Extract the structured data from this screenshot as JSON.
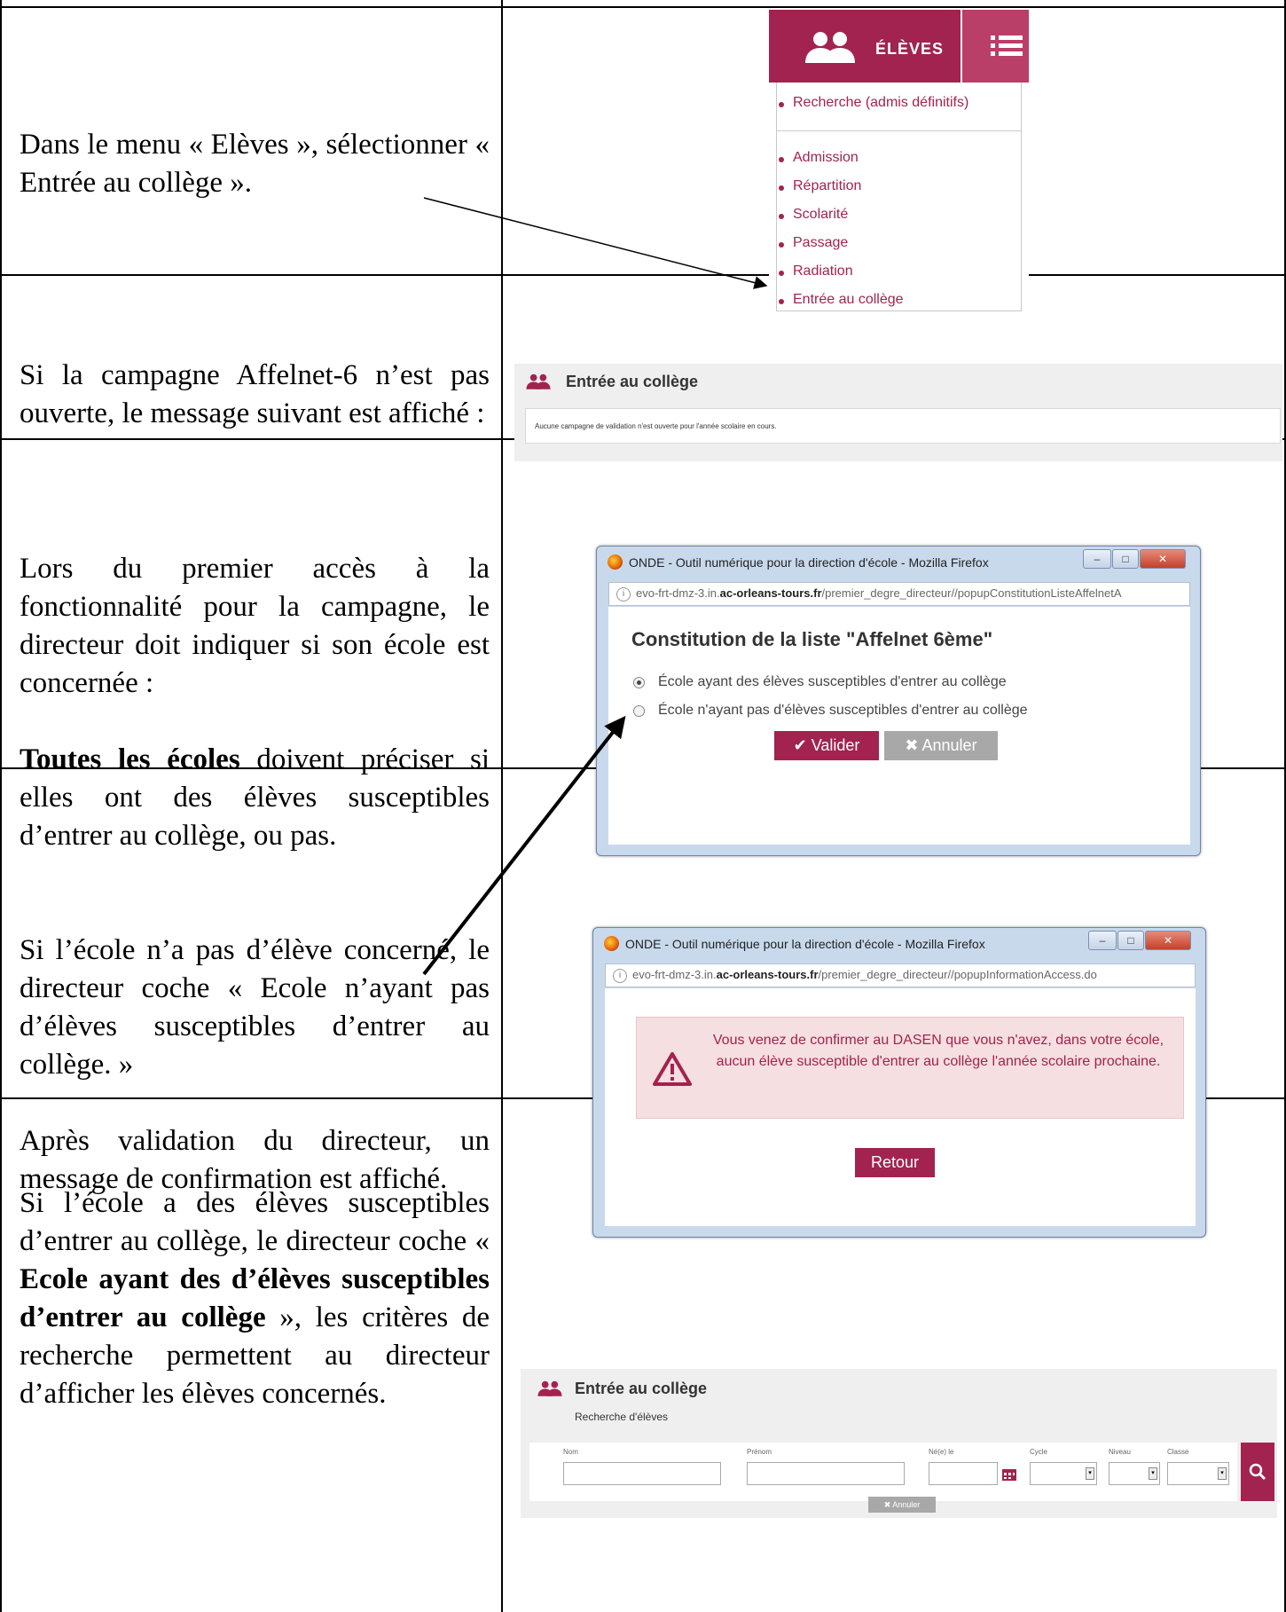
{
  "rows": [
    {
      "paragraphs": [
        [
          "Dans le menu « Elèves », sélectionner « Entrée au collège »."
        ]
      ]
    },
    {
      "paragraphs": [
        [
          "Si la campagne Affelnet-6 n’est pas ouverte, le message suivant est affiché :"
        ]
      ]
    },
    {
      "p1": "Lors du premier accès à la fonctionnalité pour la campagne, le directeur doit indiquer si son école est concernée :",
      "p2_bold": "Toutes les écoles",
      "p2_rest": " doivent préciser si elles ont des élèves susceptibles d’entrer au collège, ou pas."
    },
    {
      "p1": "Si l’école n’a pas d’élève concerné, le directeur coche « Ecole n’ayant pas d’élèves susceptibles d’entrer au collège. »",
      "p2": "Après validation du directeur, un message de confirmation est affiché."
    },
    {
      "p1_a": "Si l’école a des élèves susceptibles d’entrer au collège, le directeur coche « ",
      "p1_bold": "Ecole ayant des d’élèves susceptibles d’entrer au collège",
      "p1_b": " », les critères de recherche permettent au directeur d’afficher les élèves concernés."
    }
  ],
  "menu": {
    "header": "ÉLÈVES",
    "items": [
      "Recherche (admis définitifs)",
      "Admission",
      "Répartition",
      "Scolarité",
      "Passage",
      "Radiation",
      "Entrée au collège"
    ]
  },
  "entree_panel": {
    "title": "Entrée au collège",
    "message": "Aucune campagne de validation n'est ouverte pour l'année scolaire en cours."
  },
  "window1": {
    "title": "ONDE - Outil numérique pour la direction d'école - Mozilla Firefox",
    "url_prefix": "evo-frt-dmz-3.in.",
    "url_domain": "ac-orleans-tours.fr",
    "url_path": "/premier_degre_directeur//popupConstitutionListeAffelnetA",
    "heading": "Constitution de la liste \"Affelnet 6ème\"",
    "option1": "École ayant des élèves susceptibles d'entrer au collège",
    "option2": "École n'ayant pas d'élèves susceptibles d'entrer au collège",
    "valider": "Valider",
    "annuler": "Annuler"
  },
  "window2": {
    "title": "ONDE - Outil numérique pour la direction d'école - Mozilla Firefox",
    "url_prefix": "evo-frt-dmz-3.in.",
    "url_domain": "ac-orleans-tours.fr",
    "url_path": "/premier_degre_directeur//popupInformationAccess.do",
    "alert": "Vous venez de confirmer au DASEN que vous n'avez, dans votre école, aucun élève susceptible d'entrer au collège l'année scolaire prochaine.",
    "retour": "Retour"
  },
  "search_panel": {
    "title": "Entrée au collège",
    "subtitle": "Recherche d'élèves",
    "fields": {
      "nom": "Nom",
      "prenom": "Prénom",
      "ne_le": "Né(e) le",
      "cycle": "Cycle",
      "niveau": "Niveau",
      "classe": "Classe"
    },
    "annuler": "Annuler"
  },
  "colors": {
    "brand": "#a2234f",
    "grey_button": "#a8a8a8"
  }
}
